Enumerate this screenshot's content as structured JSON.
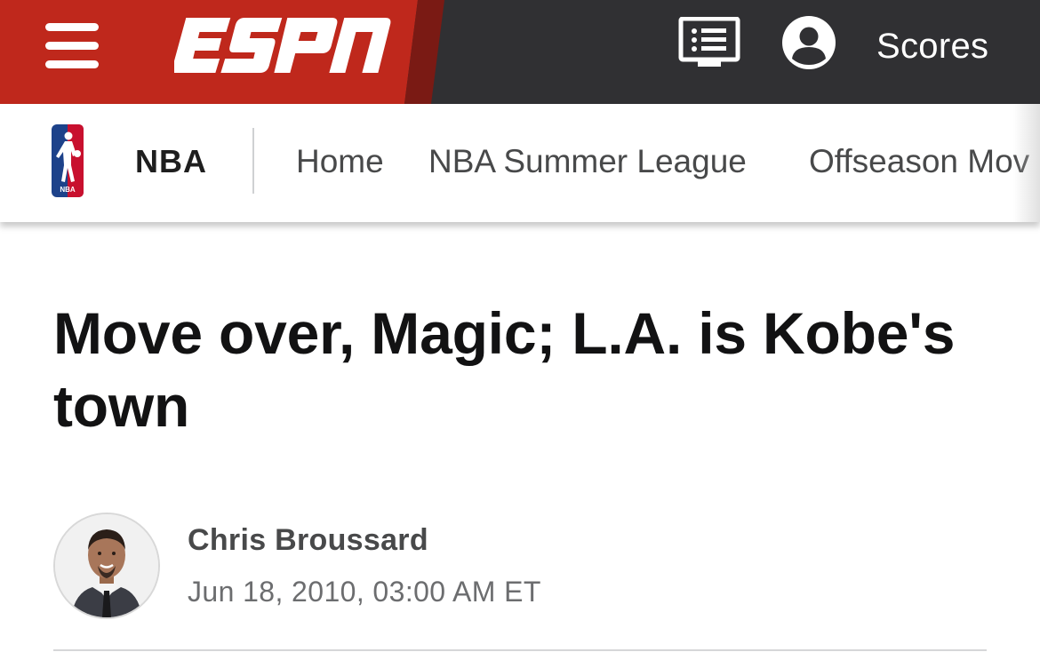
{
  "header": {
    "brand": "ESPN",
    "scores_label": "Scores",
    "menu_icon": "hamburger-menu-icon",
    "watch_icon": "watch-list-icon",
    "profile_icon": "user-profile-icon",
    "brand_color": "#bf281c",
    "bar_color": "#303033"
  },
  "subnav": {
    "league": "NBA",
    "logo_text": "NBA",
    "items": [
      {
        "label": "Home"
      },
      {
        "label": "NBA Summer League"
      },
      {
        "label": "Offseason Mov"
      }
    ]
  },
  "article": {
    "headline": "Move over, Magic; L.A. is Kobe's town",
    "author": "Chris Broussard",
    "timestamp": "Jun 18, 2010, 03:00 AM ET"
  }
}
